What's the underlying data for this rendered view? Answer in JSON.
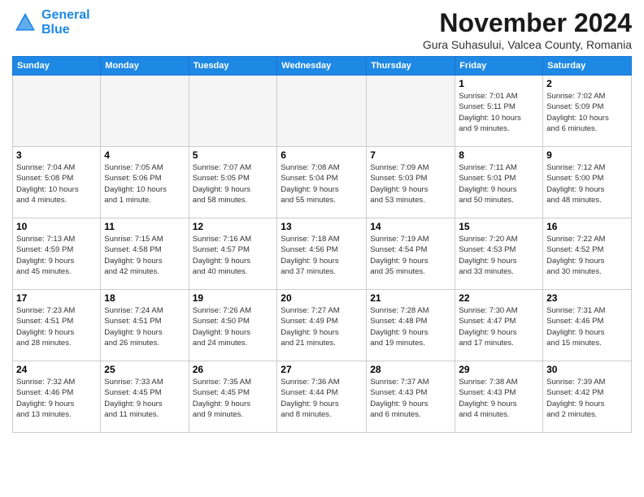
{
  "logo": {
    "line1": "General",
    "line2": "Blue"
  },
  "title": "November 2024",
  "subtitle": "Gura Suhasului, Valcea County, Romania",
  "days_of_week": [
    "Sunday",
    "Monday",
    "Tuesday",
    "Wednesday",
    "Thursday",
    "Friday",
    "Saturday"
  ],
  "weeks": [
    [
      {
        "day": "",
        "info": "",
        "empty": true
      },
      {
        "day": "",
        "info": "",
        "empty": true
      },
      {
        "day": "",
        "info": "",
        "empty": true
      },
      {
        "day": "",
        "info": "",
        "empty": true
      },
      {
        "day": "",
        "info": "",
        "empty": true
      },
      {
        "day": "1",
        "info": "Sunrise: 7:01 AM\nSunset: 5:11 PM\nDaylight: 10 hours\nand 9 minutes.",
        "empty": false
      },
      {
        "day": "2",
        "info": "Sunrise: 7:02 AM\nSunset: 5:09 PM\nDaylight: 10 hours\nand 6 minutes.",
        "empty": false
      }
    ],
    [
      {
        "day": "3",
        "info": "Sunrise: 7:04 AM\nSunset: 5:08 PM\nDaylight: 10 hours\nand 4 minutes.",
        "empty": false
      },
      {
        "day": "4",
        "info": "Sunrise: 7:05 AM\nSunset: 5:06 PM\nDaylight: 10 hours\nand 1 minute.",
        "empty": false
      },
      {
        "day": "5",
        "info": "Sunrise: 7:07 AM\nSunset: 5:05 PM\nDaylight: 9 hours\nand 58 minutes.",
        "empty": false
      },
      {
        "day": "6",
        "info": "Sunrise: 7:08 AM\nSunset: 5:04 PM\nDaylight: 9 hours\nand 55 minutes.",
        "empty": false
      },
      {
        "day": "7",
        "info": "Sunrise: 7:09 AM\nSunset: 5:03 PM\nDaylight: 9 hours\nand 53 minutes.",
        "empty": false
      },
      {
        "day": "8",
        "info": "Sunrise: 7:11 AM\nSunset: 5:01 PM\nDaylight: 9 hours\nand 50 minutes.",
        "empty": false
      },
      {
        "day": "9",
        "info": "Sunrise: 7:12 AM\nSunset: 5:00 PM\nDaylight: 9 hours\nand 48 minutes.",
        "empty": false
      }
    ],
    [
      {
        "day": "10",
        "info": "Sunrise: 7:13 AM\nSunset: 4:59 PM\nDaylight: 9 hours\nand 45 minutes.",
        "empty": false
      },
      {
        "day": "11",
        "info": "Sunrise: 7:15 AM\nSunset: 4:58 PM\nDaylight: 9 hours\nand 42 minutes.",
        "empty": false
      },
      {
        "day": "12",
        "info": "Sunrise: 7:16 AM\nSunset: 4:57 PM\nDaylight: 9 hours\nand 40 minutes.",
        "empty": false
      },
      {
        "day": "13",
        "info": "Sunrise: 7:18 AM\nSunset: 4:56 PM\nDaylight: 9 hours\nand 37 minutes.",
        "empty": false
      },
      {
        "day": "14",
        "info": "Sunrise: 7:19 AM\nSunset: 4:54 PM\nDaylight: 9 hours\nand 35 minutes.",
        "empty": false
      },
      {
        "day": "15",
        "info": "Sunrise: 7:20 AM\nSunset: 4:53 PM\nDaylight: 9 hours\nand 33 minutes.",
        "empty": false
      },
      {
        "day": "16",
        "info": "Sunrise: 7:22 AM\nSunset: 4:52 PM\nDaylight: 9 hours\nand 30 minutes.",
        "empty": false
      }
    ],
    [
      {
        "day": "17",
        "info": "Sunrise: 7:23 AM\nSunset: 4:51 PM\nDaylight: 9 hours\nand 28 minutes.",
        "empty": false
      },
      {
        "day": "18",
        "info": "Sunrise: 7:24 AM\nSunset: 4:51 PM\nDaylight: 9 hours\nand 26 minutes.",
        "empty": false
      },
      {
        "day": "19",
        "info": "Sunrise: 7:26 AM\nSunset: 4:50 PM\nDaylight: 9 hours\nand 24 minutes.",
        "empty": false
      },
      {
        "day": "20",
        "info": "Sunrise: 7:27 AM\nSunset: 4:49 PM\nDaylight: 9 hours\nand 21 minutes.",
        "empty": false
      },
      {
        "day": "21",
        "info": "Sunrise: 7:28 AM\nSunset: 4:48 PM\nDaylight: 9 hours\nand 19 minutes.",
        "empty": false
      },
      {
        "day": "22",
        "info": "Sunrise: 7:30 AM\nSunset: 4:47 PM\nDaylight: 9 hours\nand 17 minutes.",
        "empty": false
      },
      {
        "day": "23",
        "info": "Sunrise: 7:31 AM\nSunset: 4:46 PM\nDaylight: 9 hours\nand 15 minutes.",
        "empty": false
      }
    ],
    [
      {
        "day": "24",
        "info": "Sunrise: 7:32 AM\nSunset: 4:46 PM\nDaylight: 9 hours\nand 13 minutes.",
        "empty": false
      },
      {
        "day": "25",
        "info": "Sunrise: 7:33 AM\nSunset: 4:45 PM\nDaylight: 9 hours\nand 11 minutes.",
        "empty": false
      },
      {
        "day": "26",
        "info": "Sunrise: 7:35 AM\nSunset: 4:45 PM\nDaylight: 9 hours\nand 9 minutes.",
        "empty": false
      },
      {
        "day": "27",
        "info": "Sunrise: 7:36 AM\nSunset: 4:44 PM\nDaylight: 9 hours\nand 8 minutes.",
        "empty": false
      },
      {
        "day": "28",
        "info": "Sunrise: 7:37 AM\nSunset: 4:43 PM\nDaylight: 9 hours\nand 6 minutes.",
        "empty": false
      },
      {
        "day": "29",
        "info": "Sunrise: 7:38 AM\nSunset: 4:43 PM\nDaylight: 9 hours\nand 4 minutes.",
        "empty": false
      },
      {
        "day": "30",
        "info": "Sunrise: 7:39 AM\nSunset: 4:42 PM\nDaylight: 9 hours\nand 2 minutes.",
        "empty": false
      }
    ]
  ]
}
